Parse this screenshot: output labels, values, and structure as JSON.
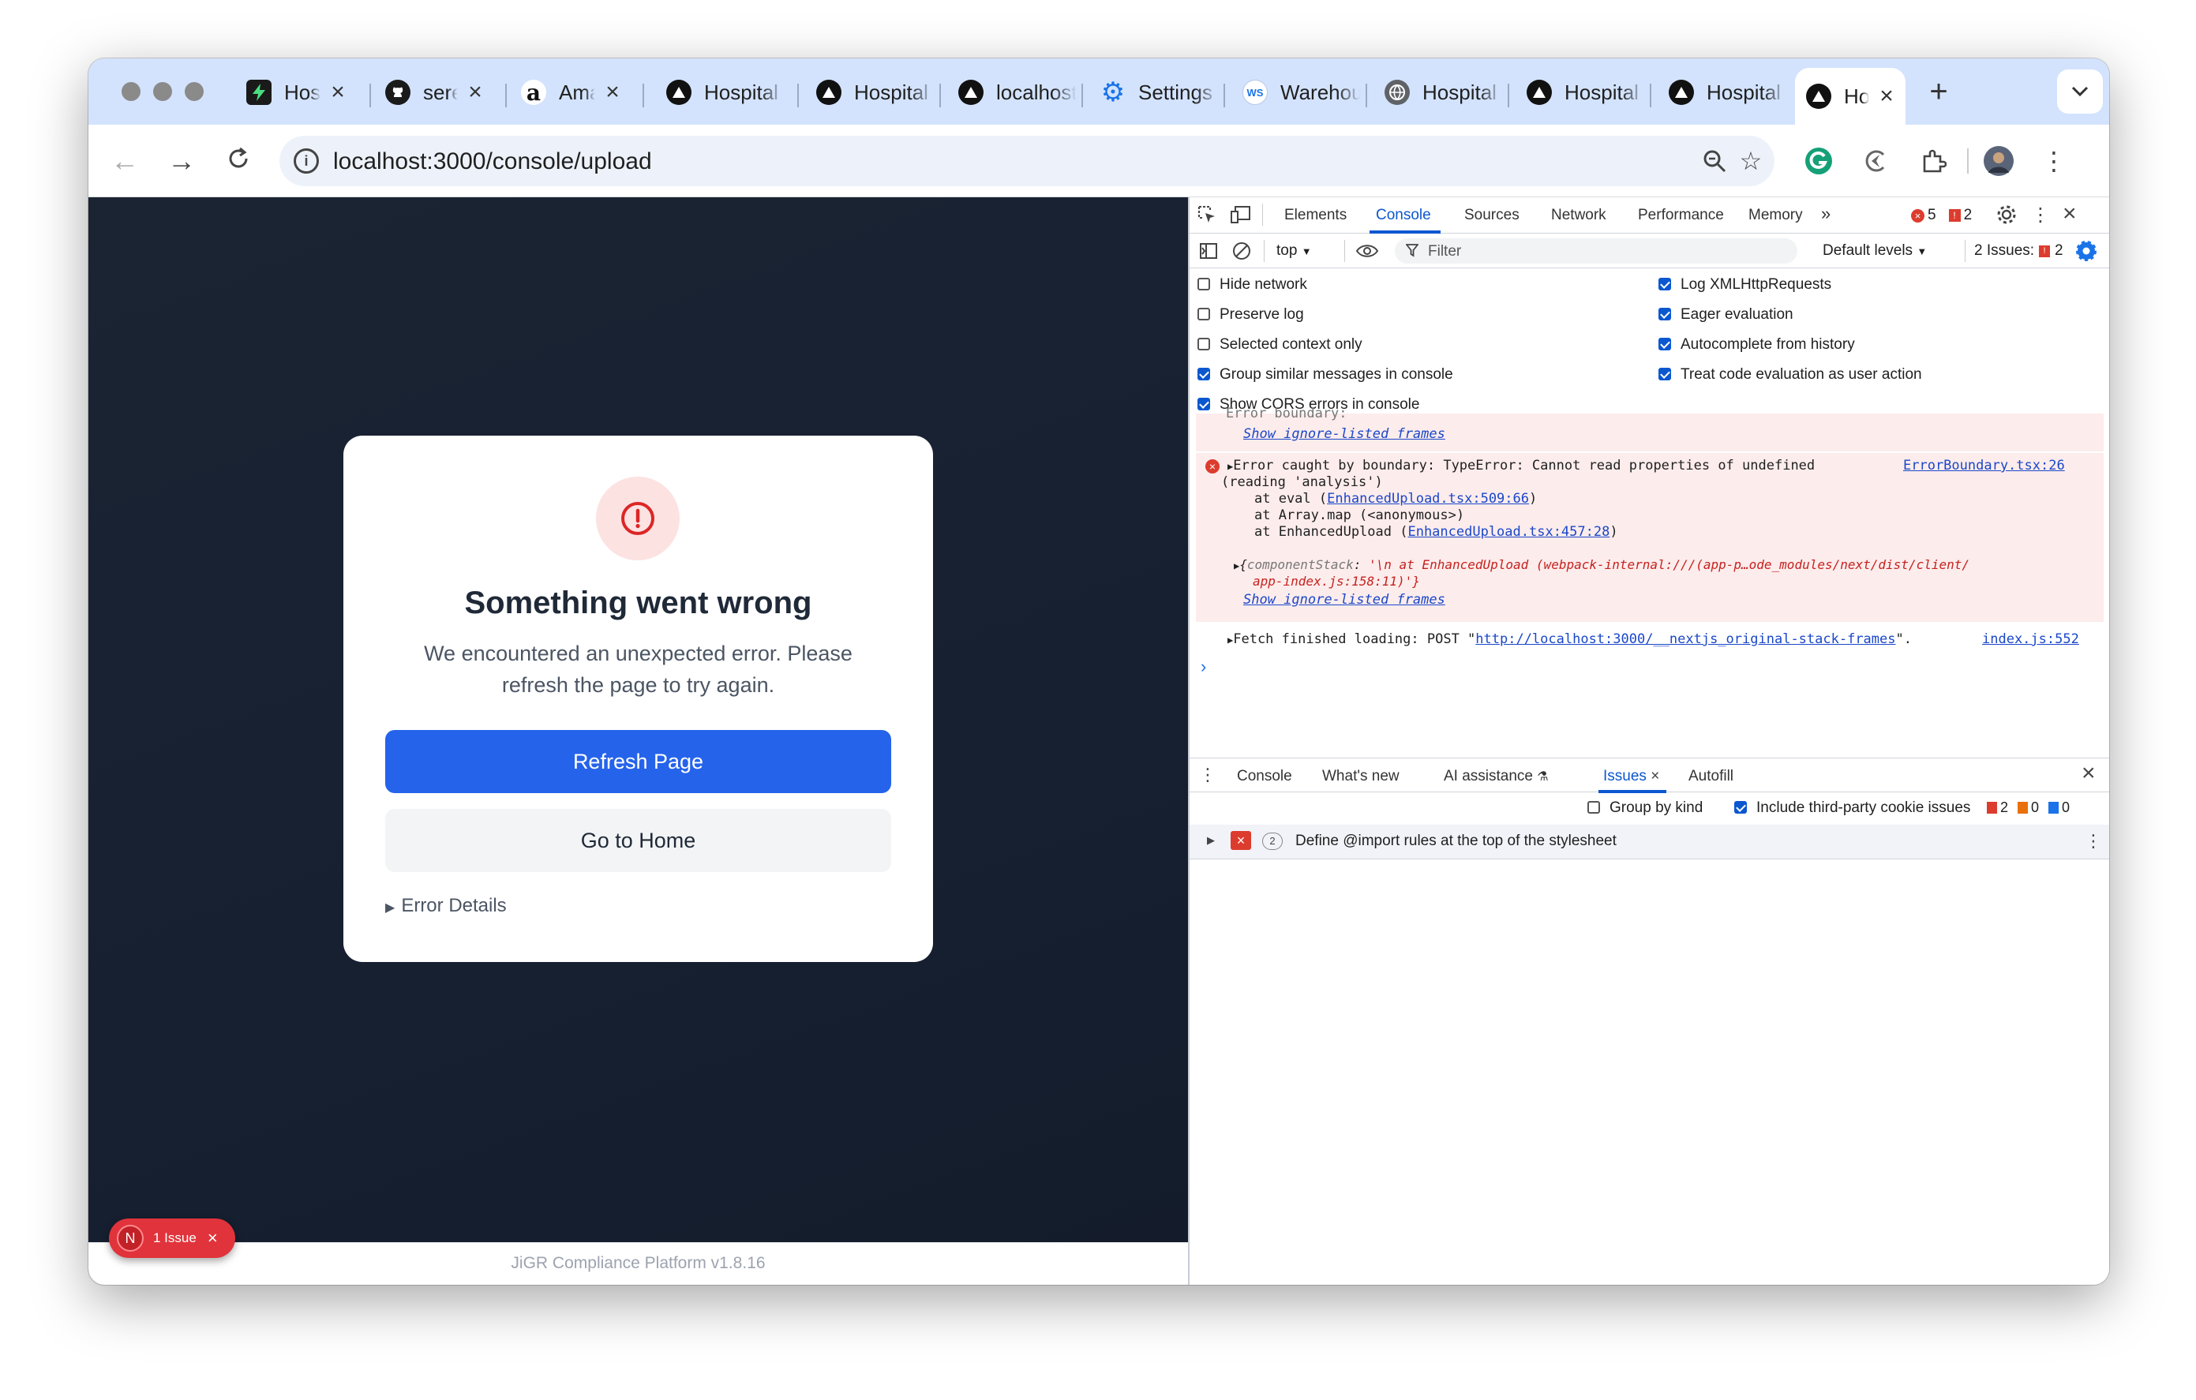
{
  "browser": {
    "tabs": [
      {
        "title": "Hospital",
        "icon": "bolt-icon"
      },
      {
        "title": "serena",
        "icon": "github-icon"
      },
      {
        "title": "Amazon",
        "icon": "amazon-icon"
      },
      {
        "title": "Hospital",
        "icon": "triangle-icon"
      },
      {
        "title": "Hospital",
        "icon": "triangle-icon"
      },
      {
        "title": "localhost",
        "icon": "triangle-icon"
      },
      {
        "title": "Settings",
        "icon": "gear-icon"
      },
      {
        "title": "Warehouse",
        "icon": "ws-icon"
      },
      {
        "title": "Hospital",
        "icon": "globe-icon"
      },
      {
        "title": "Hospital",
        "icon": "triangle-icon"
      },
      {
        "title": "Hospital",
        "icon": "triangle-icon"
      },
      {
        "title": "Hospital",
        "icon": "triangle-icon"
      }
    ],
    "url": "localhost:3000/console/upload"
  },
  "page": {
    "heading": "Something went wrong",
    "message": "We encountered an unexpected error. Please refresh the page to try again.",
    "refresh_label": "Refresh Page",
    "home_label": "Go to Home",
    "details_label": "Error Details",
    "footer": "JiGR Compliance Platform v1.8.16",
    "issue_badge": "1 Issue",
    "issue_badge_letter": "N"
  },
  "devtools": {
    "tabs": [
      "Elements",
      "Console",
      "Sources",
      "Network",
      "Performance",
      "Memory"
    ],
    "active_tab": "Console",
    "error_count": "5",
    "issue_count": "2",
    "context": "top",
    "filter_placeholder": "Filter",
    "levels": "Default levels",
    "issues_summary": "2 Issues:",
    "issues_summary_count": "2",
    "settings_left": [
      {
        "label": "Hide network",
        "checked": false
      },
      {
        "label": "Preserve log",
        "checked": false
      },
      {
        "label": "Selected context only",
        "checked": false
      },
      {
        "label": "Group similar messages in console",
        "checked": true
      },
      {
        "label": "Show CORS errors in console",
        "checked": true
      }
    ],
    "settings_right": [
      {
        "label": "Log XMLHttpRequests",
        "checked": true
      },
      {
        "label": "Eager evaluation",
        "checked": true
      },
      {
        "label": "Autocomplete from history",
        "checked": true
      },
      {
        "label": "Treat code evaluation as user action",
        "checked": true
      }
    ],
    "console": {
      "partial_line": "Error boundary:",
      "show_ignore_1": "Show ignore-listed frames",
      "error_line1": "Error caught by boundary: TypeError: Cannot read properties of undefined",
      "error_line2": "(reading 'analysis')",
      "error_source": "ErrorBoundary.tsx:26",
      "stack1_prefix": "at eval (",
      "stack1_link": "EnhancedUpload.tsx:509:66",
      "stack1_suffix": ")",
      "stack2": "at Array.map (<anonymous>)",
      "stack3_prefix": "at EnhancedUpload (",
      "stack3_link": "EnhancedUpload.tsx:457:28",
      "stack3_suffix": ")",
      "component_stack_key": "componentStack",
      "component_stack_value": "'\\n    at EnhancedUpload (webpack-internal:///(app-p…ode_modules/next/dist/client/",
      "component_stack_value2": "app-index.js:158:11)'}",
      "show_ignore_2": "Show ignore-listed frames",
      "fetch_prefix": "Fetch finished loading: POST \"",
      "fetch_link": "http://localhost:3000/__nextjs_original-stack-frames",
      "fetch_suffix": "\".",
      "fetch_source": "index.js:552"
    },
    "drawer_tabs": [
      "Console",
      "What's new",
      "AI assistance",
      "Issues",
      "Autofill"
    ],
    "active_drawer_tab": "Issues",
    "group_by_kind": "Group by kind",
    "include_third_party": "Include third-party cookie issues",
    "issue_counts": [
      "2",
      "0",
      "0"
    ],
    "issue_item_count": "2",
    "issue_item_text": "Define @import rules at the top of the stylesheet"
  },
  "colors": {
    "primary": "#2563eb",
    "error": "#dc2626",
    "page_bg": "#182130",
    "devtools_accent": "#0b57d0"
  }
}
